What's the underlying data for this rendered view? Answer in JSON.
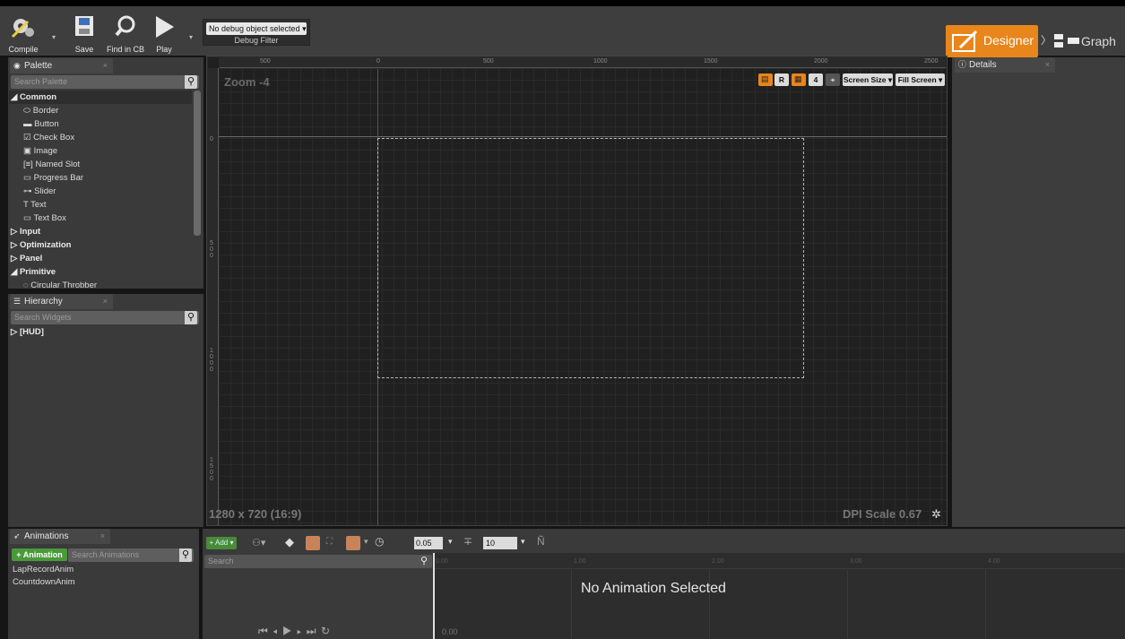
{
  "toolbar": {
    "compile": "Compile",
    "save": "Save",
    "find_in_cb": "Find in CB",
    "play": "Play",
    "debug_object": "No debug object selected ▾",
    "debug_filter": "Debug Filter"
  },
  "mode": {
    "designer": "Designer",
    "graph": "Graph"
  },
  "palette": {
    "tab": "Palette",
    "search_placeholder": "Search Palette",
    "items": [
      {
        "label": "◢ Common",
        "kind": "cat"
      },
      {
        "label": "⬭ Border",
        "kind": "item"
      },
      {
        "label": "▬ Button",
        "kind": "item"
      },
      {
        "label": "☑ Check Box",
        "kind": "item"
      },
      {
        "label": "▣ Image",
        "kind": "item"
      },
      {
        "label": "[≡] Named Slot",
        "kind": "item"
      },
      {
        "label": "▭ Progress Bar",
        "kind": "item"
      },
      {
        "label": "⊶ Slider",
        "kind": "item"
      },
      {
        "label": "T Text",
        "kind": "item"
      },
      {
        "label": "▭ Text Box",
        "kind": "item"
      },
      {
        "label": "▷ Input",
        "kind": "cat"
      },
      {
        "label": "▷ Optimization",
        "kind": "cat"
      },
      {
        "label": "▷ Panel",
        "kind": "cat"
      },
      {
        "label": "◢ Primitive",
        "kind": "cat"
      },
      {
        "label": "◌ Circular Throbber",
        "kind": "item"
      }
    ]
  },
  "hierarchy": {
    "tab": "Hierarchy",
    "search_placeholder": "Search Widgets",
    "root": "▷ [HUD]"
  },
  "canvas": {
    "zoom": "Zoom -4",
    "resolution": "1280 x 720 (16:9)",
    "dpi": "DPI Scale 0.67",
    "btn_r": "R",
    "btn_4": "4",
    "screen_size": "Screen Size ▾",
    "fill_screen": "Fill Screen ▾",
    "ruler_h": [
      "500",
      "0",
      "500",
      "1000",
      "1500",
      "2000",
      "2500"
    ],
    "ruler_v": [
      "0",
      "500",
      "1000",
      "1500"
    ]
  },
  "details": {
    "tab": "Details"
  },
  "animations": {
    "tab": "Animations",
    "add_button": "+ Animation",
    "search_placeholder": "Search Animations",
    "list": [
      "LapRecordAnim",
      "CountdownAnim"
    ]
  },
  "timeline": {
    "add": "+ Add ▾",
    "snap_value": "0.05",
    "frames_value": "10",
    "search_placeholder": "Search",
    "start_time": "0.00",
    "ticks": [
      "0.00",
      "1.00",
      "2.00",
      "3.00",
      "4.00"
    ],
    "empty_message": "No Animation Selected"
  },
  "colors": {
    "accent": "#e8861c",
    "add_green": "#4a9a3a"
  }
}
